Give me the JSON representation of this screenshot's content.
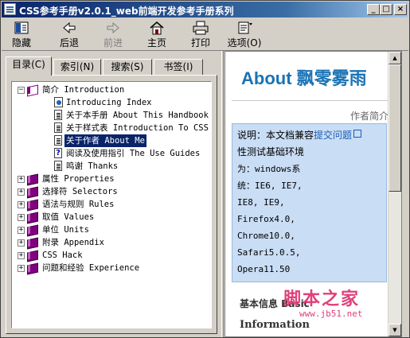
{
  "window": {
    "title": "CSS参考手册v2.0.1_web前端开发参考手册系列"
  },
  "titlebar_buttons": {
    "minimize": "_",
    "maximize": "□",
    "close": "×"
  },
  "toolbar": {
    "hide": "隐藏",
    "back": "后退",
    "forward": "前进",
    "home": "主页",
    "print": "打印",
    "options": "选项(O)"
  },
  "tabs": {
    "contents": "目录(C)",
    "index": "索引(N)",
    "search": "搜索(S)",
    "bookmarks": "书签(I)"
  },
  "tree": {
    "root": "简介 Introduction",
    "children": [
      "Introducing Index",
      "关于本手册 About This Handbook",
      "关于样式表 Introduction To CSS",
      "关于作者 About Me",
      "阅读及使用指引 The Use Guides",
      "鸣谢 Thanks"
    ],
    "books": [
      "属性 Properties",
      "选择符 Selectors",
      "语法与规则 Rules",
      "取值 Values",
      "单位 Units",
      "附录 Appendix",
      "CSS Hack",
      "问题和经验 Experience"
    ],
    "expander_collapsed": "+",
    "expander_expanded": "−"
  },
  "content": {
    "title": "About 飘零雾雨",
    "author_link": "作者简介",
    "notice_line1_prefix": "说明：本文档兼容",
    "notice_link": "提交问题",
    "notice_line2": "性测试基础环境",
    "notice_line3": "为：windows系",
    "notice_line4": "统：IE6, IE7,",
    "notice_line5": "IE8, IE9,",
    "notice_line6": "Firefox4.0,",
    "notice_line7": "Chrome10.0,",
    "notice_line8": "Safari5.0.5,",
    "notice_line9": "Opera11.50",
    "section1": "基本信息 Basic",
    "section2": "Information"
  },
  "watermark": {
    "text1": "脚本之家",
    "text2": "www.jb51.net"
  },
  "colors": {
    "title_blue": "#1a73b5",
    "notice_bg": "#c9ddf5",
    "selection": "#0a246a"
  }
}
